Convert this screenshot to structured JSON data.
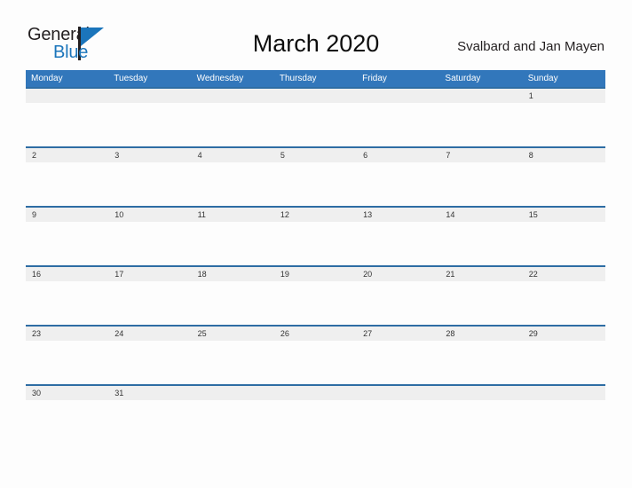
{
  "brand": {
    "logo_primary": "General",
    "logo_secondary": "Blue",
    "triangle_icon": "blue-triangle-icon",
    "accent_color": "#1b75bb"
  },
  "header": {
    "title": "March 2020",
    "subtitle": "Svalbard and Jan Mayen"
  },
  "calendar": {
    "header_color": "#3277bb",
    "row_line_color": "#2e6da4",
    "number_band_color": "#efefef",
    "weekdays": [
      "Monday",
      "Tuesday",
      "Wednesday",
      "Thursday",
      "Friday",
      "Saturday",
      "Sunday"
    ],
    "weeks": [
      [
        "",
        "",
        "",
        "",
        "",
        "",
        "1"
      ],
      [
        "2",
        "3",
        "4",
        "5",
        "6",
        "7",
        "8"
      ],
      [
        "9",
        "10",
        "11",
        "12",
        "13",
        "14",
        "15"
      ],
      [
        "16",
        "17",
        "18",
        "19",
        "20",
        "21",
        "22"
      ],
      [
        "23",
        "24",
        "25",
        "26",
        "27",
        "28",
        "29"
      ],
      [
        "30",
        "31",
        "",
        "",
        "",
        "",
        ""
      ]
    ]
  }
}
